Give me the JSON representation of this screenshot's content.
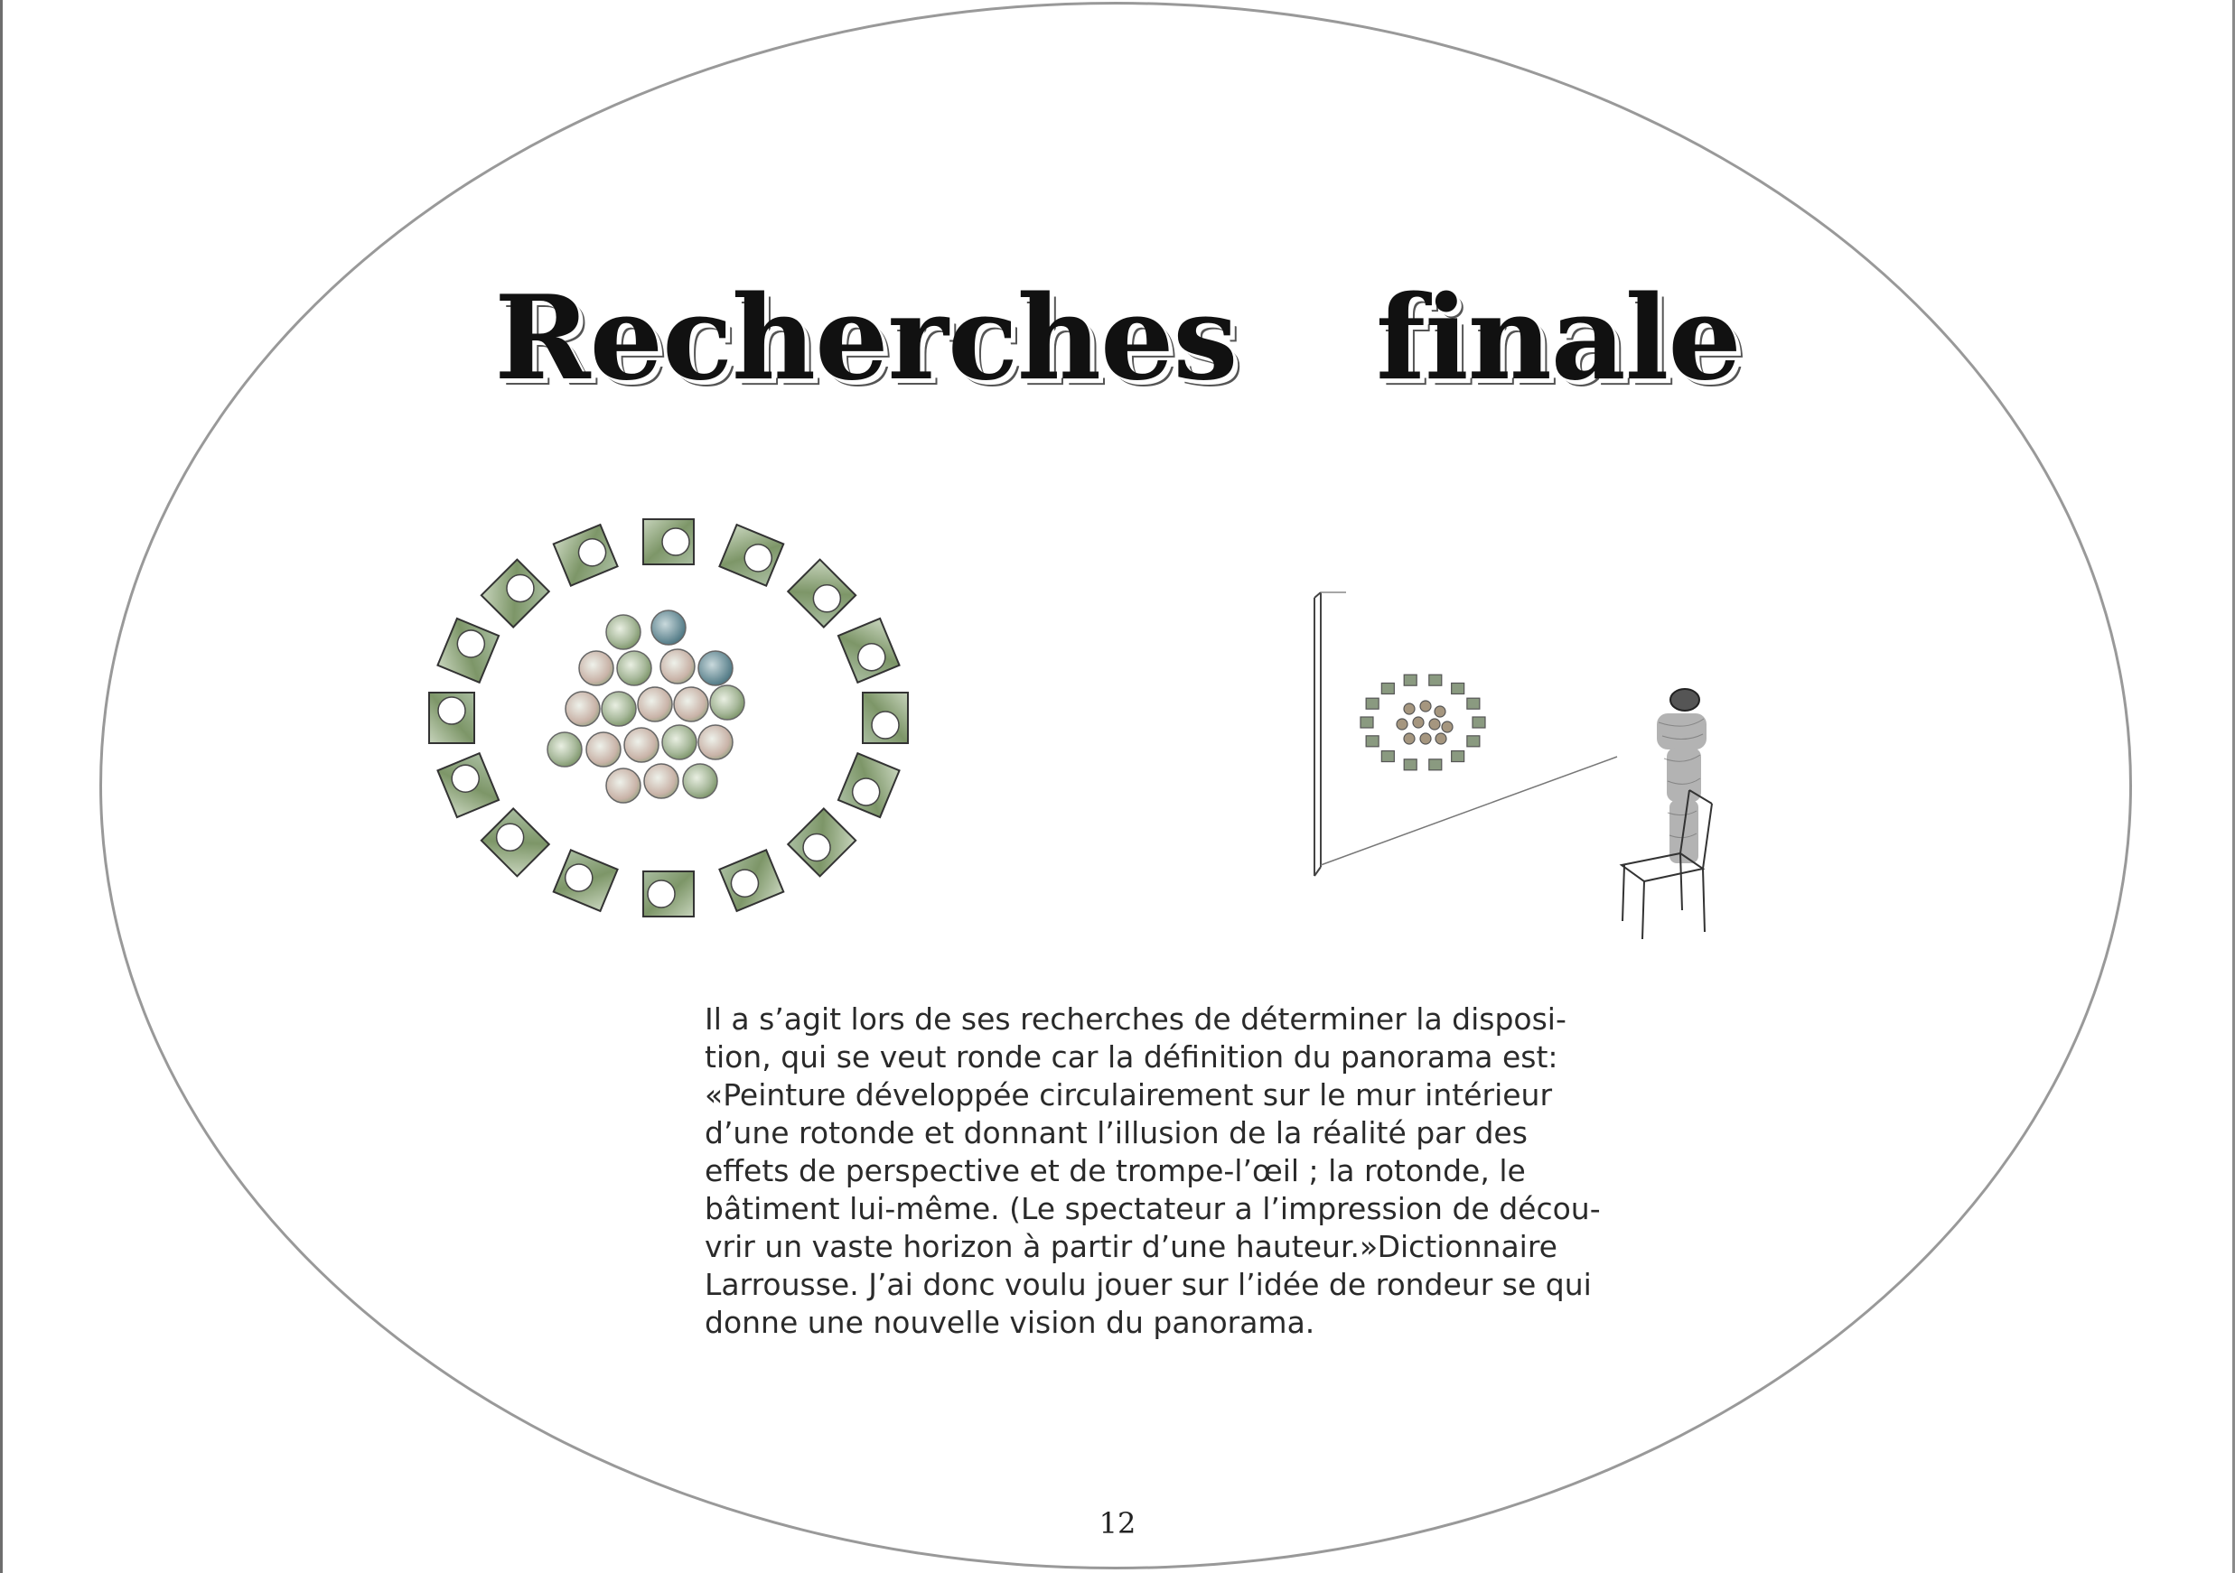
{
  "page": {
    "title_words": [
      "Recherches",
      "finale"
    ],
    "body_lines": [
      "Il a s’agit lors de ses recherches de déterminer la disposi-",
      "tion, qui se veut ronde car la définition du panorama est:",
      "«Peinture développée circulairement sur le mur intérieur",
      "d’une rotonde et donnant l’illusion de la réalité par des",
      "effets de perspective et de trompe-l’œil ; la rotonde, le",
      "bâtiment lui-même. (Le spectateur a l’impression de décou-",
      "vrir un vaste horizon à partir d’une hauteur.»Dictionnaire",
      "Larrousse. J’ai donc voulu jouer sur l’idée de rondeur se qui",
      "donne une nouvelle vision du panorama."
    ],
    "page_number": "12"
  },
  "colors": {
    "frame": "#999999",
    "text": "#2a2a2a",
    "sketch_green": "#6f8a5a",
    "sketch_teal": "#3f6b78",
    "sketch_rose": "#b07a6e"
  }
}
